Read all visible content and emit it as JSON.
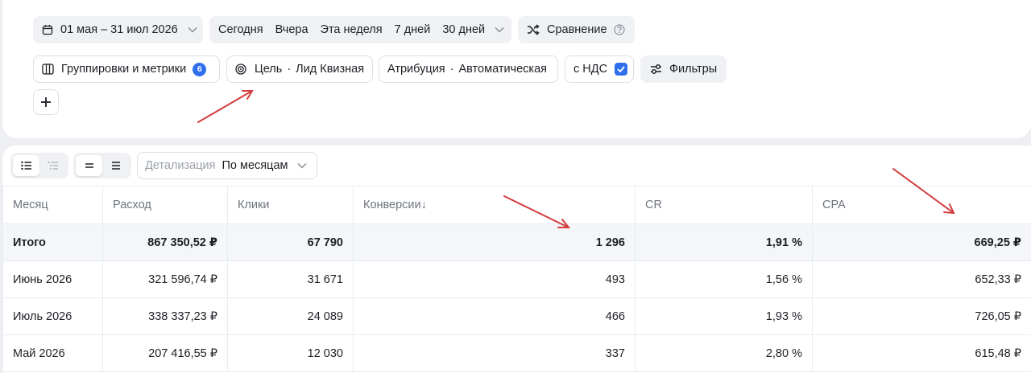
{
  "toolbar": {
    "date_range": "01 мая – 31 июл 2026",
    "periods": [
      "Сегодня",
      "Вчера",
      "Эта неделя",
      "7 дней",
      "30 дней"
    ],
    "compare_label": "Сравнение",
    "groupings_label": "Группировки и метрики",
    "groupings_count": "6",
    "goal_label": "Цель",
    "goal_value": "Лид Квизная",
    "attribution_label": "Атрибуция",
    "attribution_value": "Автоматическая",
    "vat_label": "с НДС",
    "vat_checked": true,
    "filters_label": "Фильтры",
    "dot_separator": "·"
  },
  "table_controls": {
    "detail_label": "Детализация",
    "detail_value": "По месяцам"
  },
  "table": {
    "columns": [
      "Месяц",
      "Расход",
      "Клики",
      "Конверсии↓",
      "CR",
      "CPA"
    ],
    "total": [
      "Итого",
      "867 350,52 ₽",
      "67 790",
      "1 296",
      "1,91 %",
      "669,25 ₽"
    ],
    "rows": [
      [
        "Июнь 2026",
        "321 596,74 ₽",
        "31 671",
        "493",
        "1,56 %",
        "652,33 ₽"
      ],
      [
        "Июль 2026",
        "338 337,23 ₽",
        "24 089",
        "466",
        "1,93 %",
        "726,05 ₽"
      ],
      [
        "Май 2026",
        "207 416,55 ₽",
        "12 030",
        "337",
        "2,80 %",
        "615,48 ₽"
      ]
    ]
  },
  "colors": {
    "accent": "#2f6fec",
    "annotation_arrow": "#d23c3c",
    "background": "#edeff3"
  }
}
